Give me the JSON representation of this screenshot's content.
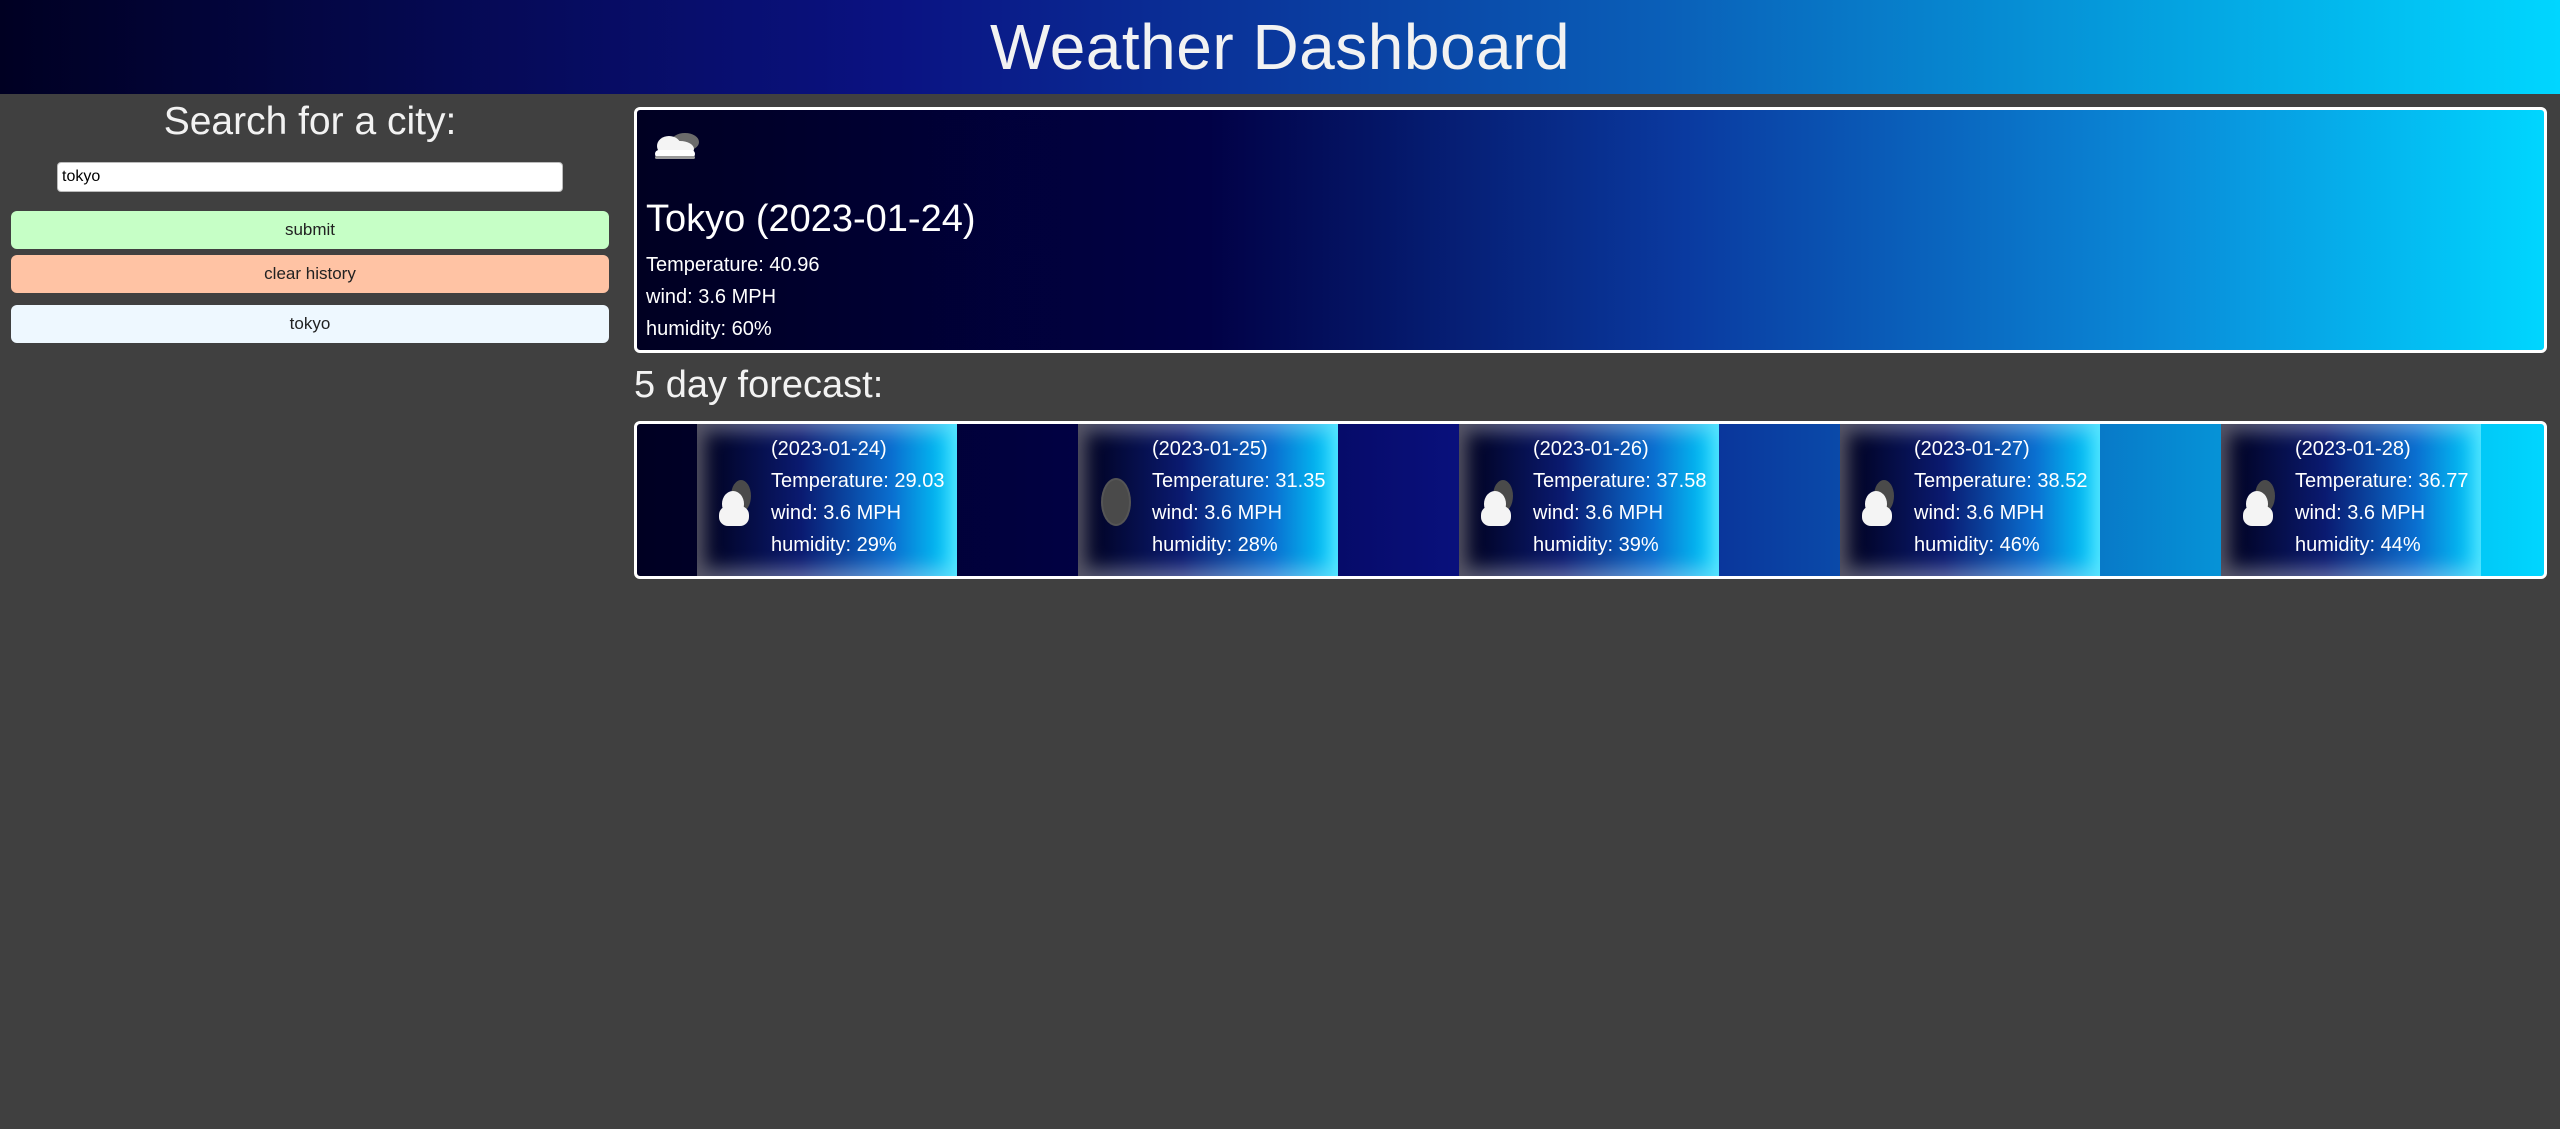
{
  "header": {
    "title": "Weather Dashboard"
  },
  "sidebar": {
    "title": "Search for a city:",
    "search_value": "tokyo",
    "submit_label": "submit",
    "clear_label": "clear history",
    "history": [
      "tokyo"
    ]
  },
  "current": {
    "icon": "partly-cloudy-icon",
    "city_date": "Tokyo (2023-01-24)",
    "temperature": "Temperature: 40.96",
    "wind": "wind: 3.6 MPH",
    "humidity": "humidity: 60%"
  },
  "forecast": {
    "title": "5 day forecast:",
    "days": [
      {
        "date": "(2023-01-24)",
        "temperature": "Temperature: 29.03",
        "wind": "wind: 3.6 MPH",
        "humidity": "humidity: 29%",
        "icon": "cloud-icon"
      },
      {
        "date": "(2023-01-25)",
        "temperature": "Temperature: 31.35",
        "wind": "wind: 3.6 MPH",
        "humidity": "humidity: 28%",
        "icon": "moon-icon"
      },
      {
        "date": "(2023-01-26)",
        "temperature": "Temperature: 37.58",
        "wind": "wind: 3.6 MPH",
        "humidity": "humidity: 39%",
        "icon": "cloud-icon"
      },
      {
        "date": "(2023-01-27)",
        "temperature": "Temperature: 38.52",
        "wind": "wind: 3.6 MPH",
        "humidity": "humidity: 46%",
        "icon": "cloud-icon"
      },
      {
        "date": "(2023-01-28)",
        "temperature": "Temperature: 36.77",
        "wind": "wind: 3.6 MPH",
        "humidity": "humidity: 44%",
        "icon": "cloud-icon"
      }
    ]
  },
  "colors": {
    "page_background": "#404040",
    "submit_button": "#c6ffc6",
    "clear_button": "#ffc3a4",
    "history_button": "#eef8ff",
    "gradient_dark": "#000022",
    "gradient_light": "#00d6ff"
  }
}
